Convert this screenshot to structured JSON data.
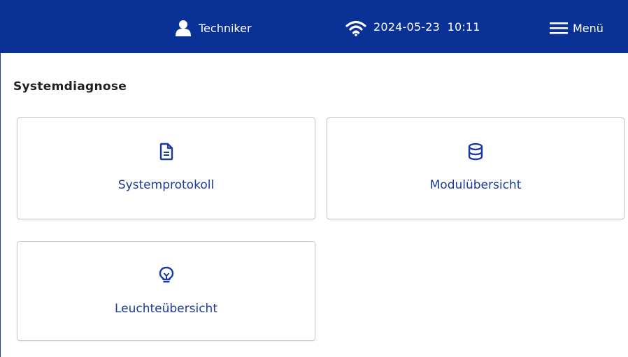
{
  "header": {
    "user_name": "Techniker",
    "user_icon": "user-icon",
    "wifi_icon": "wifi-icon",
    "date": "2024-05-23",
    "time": "10:11",
    "menu_label": "Menü",
    "menu_icon": "hamburger-icon",
    "bar_color": "#0a3296"
  },
  "main": {
    "title": "Systemdiagnose",
    "tiles": [
      {
        "label": "Systemprotokoll",
        "icon": "document-icon"
      },
      {
        "label": "Modulübersicht",
        "icon": "database-icon"
      },
      {
        "label": "Leuchteübersicht",
        "icon": "lightbulb-icon"
      }
    ],
    "accent_color": "#1a3aa0"
  }
}
